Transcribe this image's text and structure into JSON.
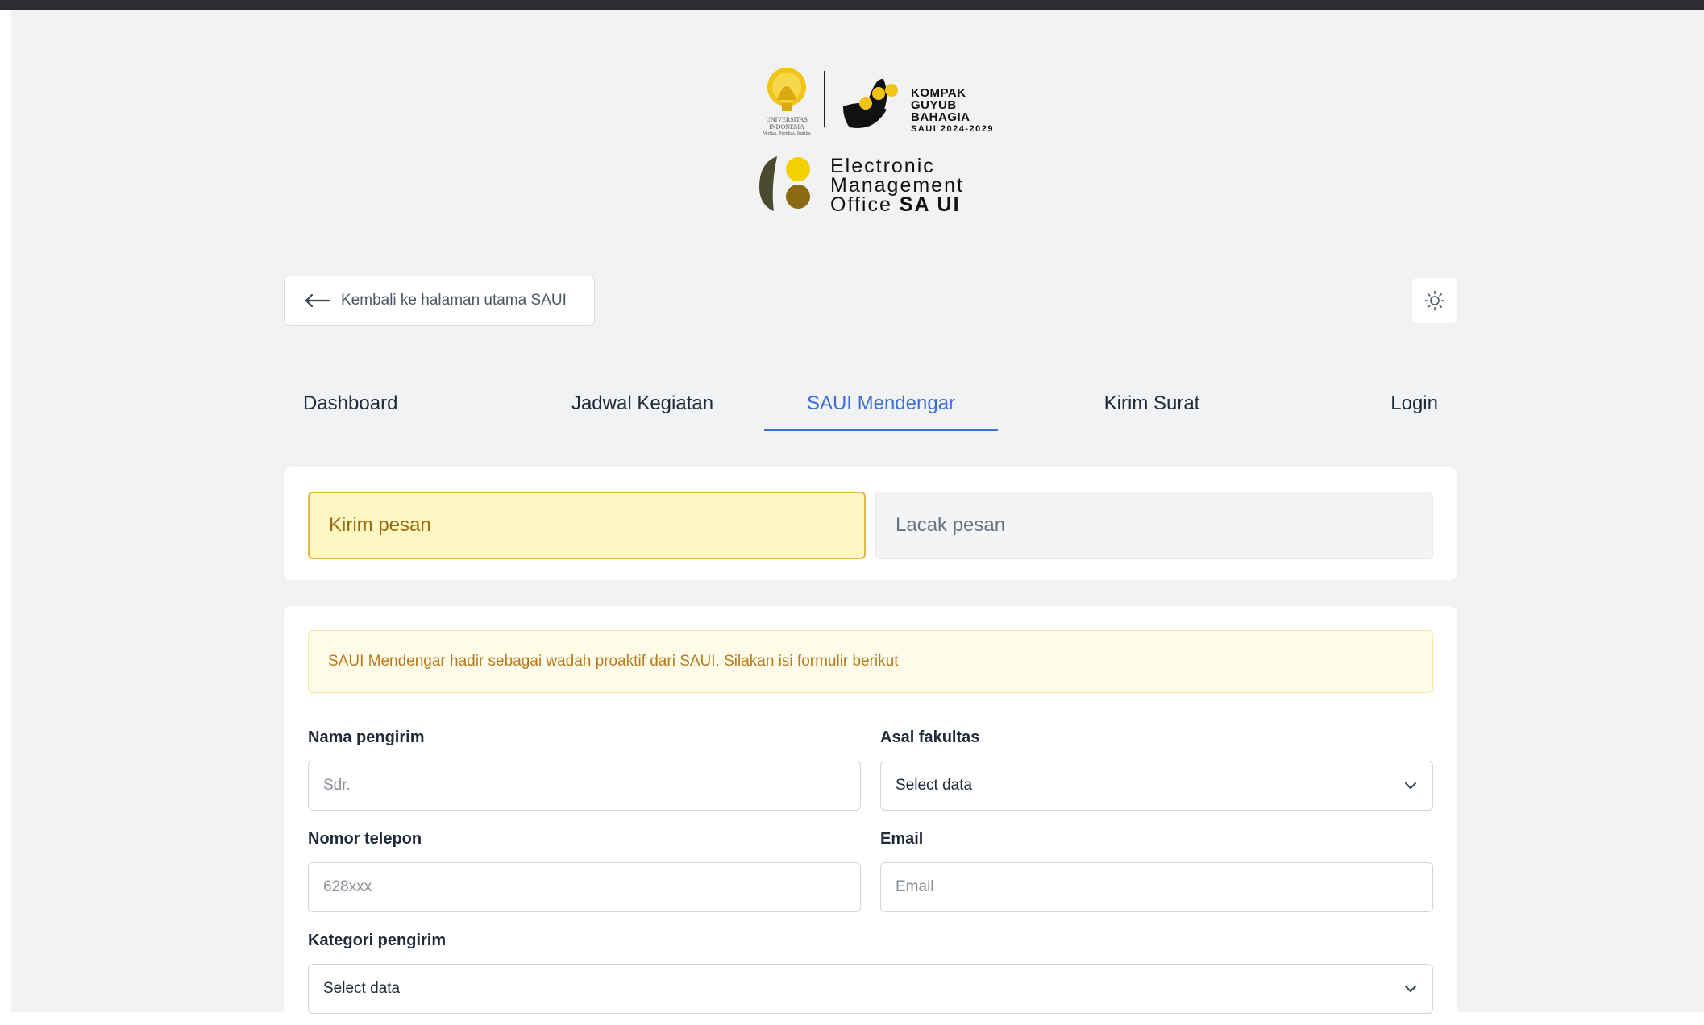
{
  "header": {
    "ui_seal_text": [
      "UNIVERSITAS",
      "INDONESIA",
      "Veritas, Probitas, Iustitia"
    ],
    "kgb_lines": [
      "KOMPAK",
      "GUYUB",
      "BAHAGIA"
    ],
    "kgb_sub": "SAUI 2024-2029",
    "emo_line1": "Electronic",
    "emo_line2": "Management",
    "emo_line3_prefix": "Office",
    "emo_line3_bold": "SA UI"
  },
  "back_button": {
    "label": "Kembali ke halaman utama SAUI",
    "icon": "arrow-left-icon"
  },
  "theme_toggle": {
    "icon": "sun-icon"
  },
  "tabs": [
    {
      "label": "Dashboard",
      "active": false
    },
    {
      "label": "Jadwal Kegiatan",
      "active": false
    },
    {
      "label": "SAUI Mendengar",
      "active": true
    },
    {
      "label": "Kirim Surat",
      "active": false
    },
    {
      "label": "Login",
      "active": false
    }
  ],
  "mode_switch": {
    "kirim": "Kirim pesan",
    "lacak": "Lacak pesan"
  },
  "form": {
    "alert": "SAUI Mendengar hadir sebagai wadah proaktif dari SAUI. Silakan isi formulir berikut",
    "nama_label": "Nama pengirim",
    "nama_placeholder": "Sdr.",
    "fakultas_label": "Asal fakultas",
    "fakultas_value": "Select data",
    "telepon_label": "Nomor telepon",
    "telepon_placeholder": "628xxx",
    "email_label": "Email",
    "email_placeholder": "Email",
    "kategori_label": "Kategori pengirim",
    "kategori_value": "Select data"
  },
  "colors": {
    "accent": "#3b6fd8",
    "kirim_bg": "#fef7c3",
    "kirim_border": "#e0b94b",
    "alert_text": "#b7791f",
    "page_bg": "#f1f2f4"
  }
}
